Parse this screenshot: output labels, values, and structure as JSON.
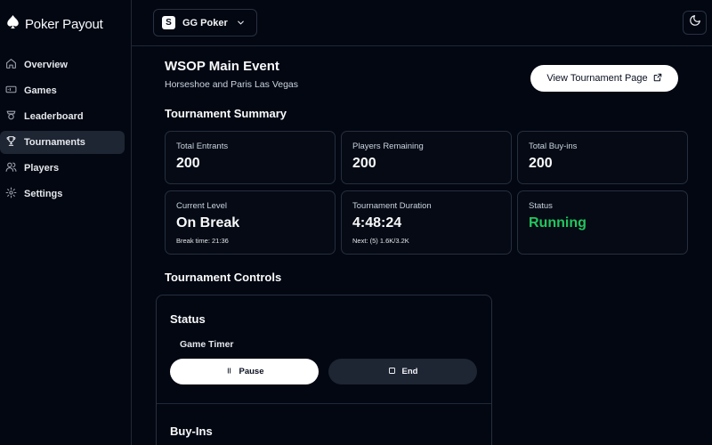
{
  "app": {
    "name": "Poker Payout"
  },
  "sidebar": {
    "items": [
      {
        "label": "Overview",
        "icon": "home-icon"
      },
      {
        "label": "Games",
        "icon": "ticket-icon"
      },
      {
        "label": "Leaderboard",
        "icon": "trophy-icon"
      },
      {
        "label": "Tournaments",
        "icon": "trophy-icon",
        "active": true
      },
      {
        "label": "Players",
        "icon": "users-icon"
      },
      {
        "label": "Settings",
        "icon": "gear-icon"
      }
    ]
  },
  "topbar": {
    "site_badge": "S",
    "site_name": "GG Poker",
    "theme_icon": "moon-icon"
  },
  "header": {
    "title": "WSOP Main Event",
    "subtitle": "Horseshoe and Paris Las Vegas",
    "view_button": "View Tournament Page"
  },
  "summary": {
    "heading": "Tournament Summary",
    "cards": [
      {
        "label": "Total Entrants",
        "value": "200"
      },
      {
        "label": "Players Remaining",
        "value": "200"
      },
      {
        "label": "Total Buy-ins",
        "value": "200"
      },
      {
        "label": "Current Level",
        "value": "On Break",
        "sub": "Break time: 21:36"
      },
      {
        "label": "Tournament Duration",
        "value": "4:48:24",
        "sub": "Next: (5) 1.6K/3.2K"
      },
      {
        "label": "Status",
        "value": "Running"
      }
    ]
  },
  "controls": {
    "heading": "Tournament Controls",
    "status_heading": "Status",
    "timer_label": "Game Timer",
    "pause_label": "Pause",
    "end_label": "End",
    "buyins_heading": "Buy-Ins"
  },
  "colors": {
    "background": "#030712",
    "status_running": "#22c55e"
  }
}
